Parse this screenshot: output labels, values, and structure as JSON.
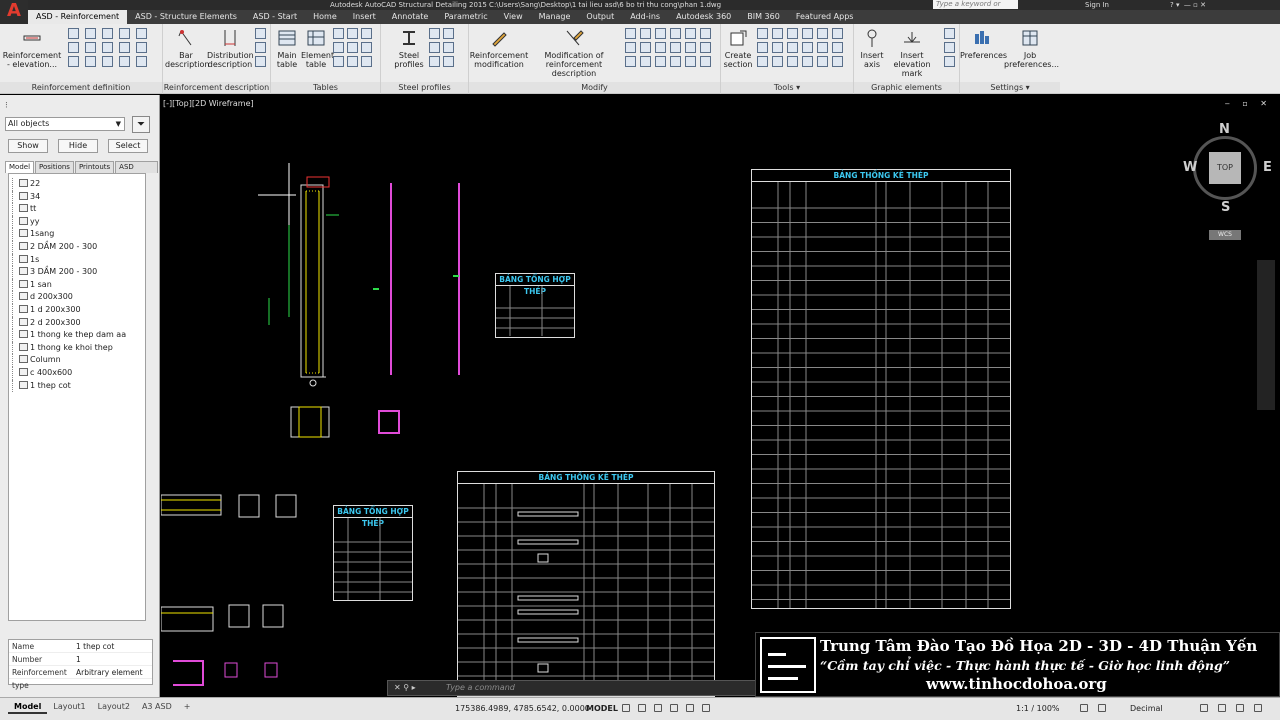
{
  "titlebar": {
    "title": "Autodesk AutoCAD Structural Detailing 2015   C:\\Users\\Sang\\Desktop\\1 tai lieu asd\\6 bo tri thu cong\\phan 1.dwg",
    "search_placeholder": "Type a keyword or phrase",
    "sign_in": "Sign In"
  },
  "app_button": "A",
  "tabs": [
    "ASD - Reinforcement",
    "ASD - Structure Elements",
    "ASD - Start",
    "Home",
    "Insert",
    "Annotate",
    "Parametric",
    "View",
    "Manage",
    "Output",
    "Add-ins",
    "Autodesk 360",
    "BIM 360",
    "Featured Apps"
  ],
  "ribbon": {
    "panels": [
      {
        "label": "Reinforcement definition",
        "buttons": [
          "Reinforcement - elevation..."
        ]
      },
      {
        "label": "Reinforcement description",
        "buttons": [
          "Bar description",
          "Distribution description"
        ]
      },
      {
        "label": "Tables",
        "buttons": [
          "Main table",
          "Element table"
        ]
      },
      {
        "label": "Steel profiles definition",
        "buttons": [
          "Steel profiles"
        ]
      },
      {
        "label": "Modify",
        "buttons": [
          "Reinforcement modification",
          "Modification of reinforcement description"
        ]
      },
      {
        "label": "Tools",
        "buttons": [
          "Create section"
        ]
      },
      {
        "label": "Graphic elements",
        "buttons": [
          "Insert axis",
          "Insert elevation mark"
        ]
      },
      {
        "label": "Settings",
        "buttons": [
          "Preferences",
          "Job preferences..."
        ]
      }
    ]
  },
  "left_panel": {
    "filter_value": "All objects",
    "show_label": "Show",
    "hide_label": "Hide",
    "select_label": "Select",
    "tabs": [
      "Model",
      "Positions",
      "Printouts",
      "ASD Center"
    ],
    "tree_items": [
      "22",
      "34",
      "tt",
      "yy",
      "1sang",
      "2 DẦM 200 - 300",
      "1s",
      "3 DẦM 200 - 300",
      "1 san",
      "d 200x300",
      "1 d 200x300",
      "2 d 200x300",
      "1 thong ke thep dam aa",
      "1 thong ke khoi thep",
      "Column",
      "c 400x600",
      "1 thep cot"
    ],
    "properties": [
      {
        "key": "Name",
        "value": "1 thep cot"
      },
      {
        "key": "Number",
        "value": "1"
      },
      {
        "key": "Reinforcement type",
        "value": "Arbitrary element"
      }
    ]
  },
  "viewport": {
    "label": "[-][Top][2D Wireframe]",
    "viewcube": {
      "n": "N",
      "s": "S",
      "e": "E",
      "w": "W",
      "face": "TOP",
      "wcs": "WCS"
    }
  },
  "tables": {
    "big_title": "BẢNG THỐNG KÊ THÉP",
    "small_title": "BẢNG TỔNG HỢP THÉP"
  },
  "command_line": {
    "placeholder": "Type a command"
  },
  "watermark": {
    "line1": "Trung Tâm Đào Tạo Đồ Họa 2D - 3D - 4D Thuận Yến",
    "line2": "“Cầm tay chỉ việc - Thực hành thực tế - Giờ học linh động”",
    "line3": "www.tinhocdohoa.org"
  },
  "statusbar": {
    "tabs": [
      "Model",
      "Layout1",
      "Layout2",
      "A3 ASD"
    ],
    "coords": "175386.4989, 4785.6542, 0.0000",
    "model": "MODEL",
    "scale": "1:1 / 100%",
    "units": "Decimal"
  },
  "colors": {
    "accent": "#3c3c3c",
    "table_title": "#3cc8f0",
    "rebar": "#f2e600",
    "column_bar": "#e04bd8"
  }
}
